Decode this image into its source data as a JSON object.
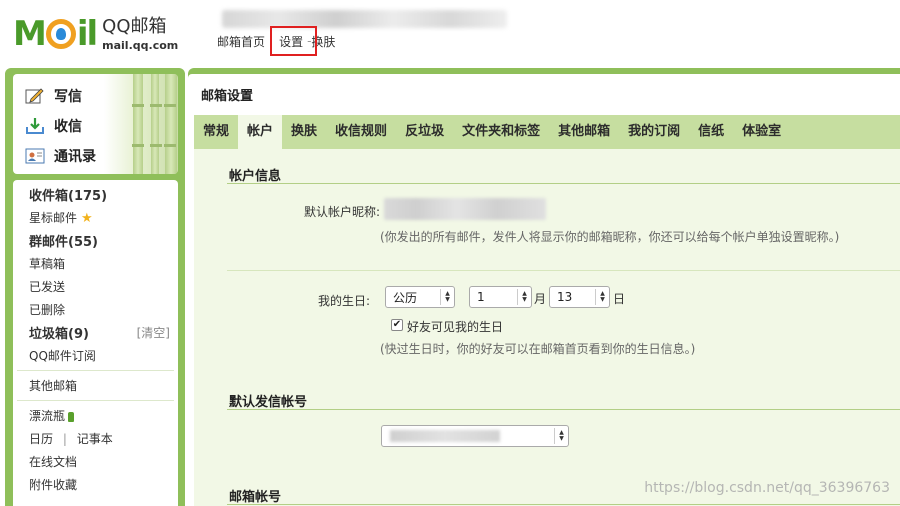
{
  "header": {
    "logo_word": "Mil",
    "logo_qq": "QQ邮箱",
    "logo_url": "mail.qq.com",
    "nav": {
      "home": "邮箱首页",
      "settings": "设置",
      "skin": "换肤"
    }
  },
  "sidebar": {
    "quick": [
      {
        "label": "写信",
        "icon": "compose-icon"
      },
      {
        "label": "收信",
        "icon": "inbox-download-icon"
      },
      {
        "label": "通讯录",
        "icon": "contacts-icon"
      }
    ],
    "folders": {
      "inbox": "收件箱(175)",
      "starred": "星标邮件",
      "group": "群邮件(55)",
      "drafts": "草稿箱",
      "sent": "已发送",
      "deleted": "已删除",
      "spam": "垃圾箱(9)",
      "spam_clear": "[清空]",
      "subscribe": "QQ邮件订阅",
      "other": "其他邮箱",
      "bottle": "漂流瓶",
      "calendar": "日历",
      "cal_sep": "|",
      "notes": "记事本",
      "docs": "在线文档",
      "attachments": "附件收藏"
    }
  },
  "main": {
    "title": "邮箱设置",
    "tabs": [
      "常规",
      "帐户",
      "换肤",
      "收信规则",
      "反垃圾",
      "文件夹和标签",
      "其他邮箱",
      "我的订阅",
      "信纸",
      "体验室"
    ],
    "active_tab": "帐户",
    "account_info": {
      "heading": "帐户信息",
      "nickname_label": "默认帐户昵称:",
      "nickname_hint": "(你发出的所有邮件，发件人将显示你的邮箱昵称，你还可以给每个帐户单独设置昵称。)"
    },
    "birthday": {
      "label": "我的生日:",
      "calendar_value": "公历",
      "month_value": "1",
      "month_unit": "月",
      "day_value": "13",
      "day_unit": "日",
      "visible_label": "好友可见我的生日",
      "visible_checked": true,
      "hint": "(快过生日时，你的好友可以在邮箱首页看到你的生日信息。)"
    },
    "default_sender": {
      "heading": "默认发信帐号"
    },
    "mail_account": {
      "heading": "邮箱帐号"
    }
  },
  "watermark": "https://blog.csdn.net/qq_36396763",
  "colors": {
    "brand_green": "#8fbf5a",
    "tab_bar": "#c6dea0",
    "panel": "#f2f8e6",
    "highlight": "#e02020"
  }
}
